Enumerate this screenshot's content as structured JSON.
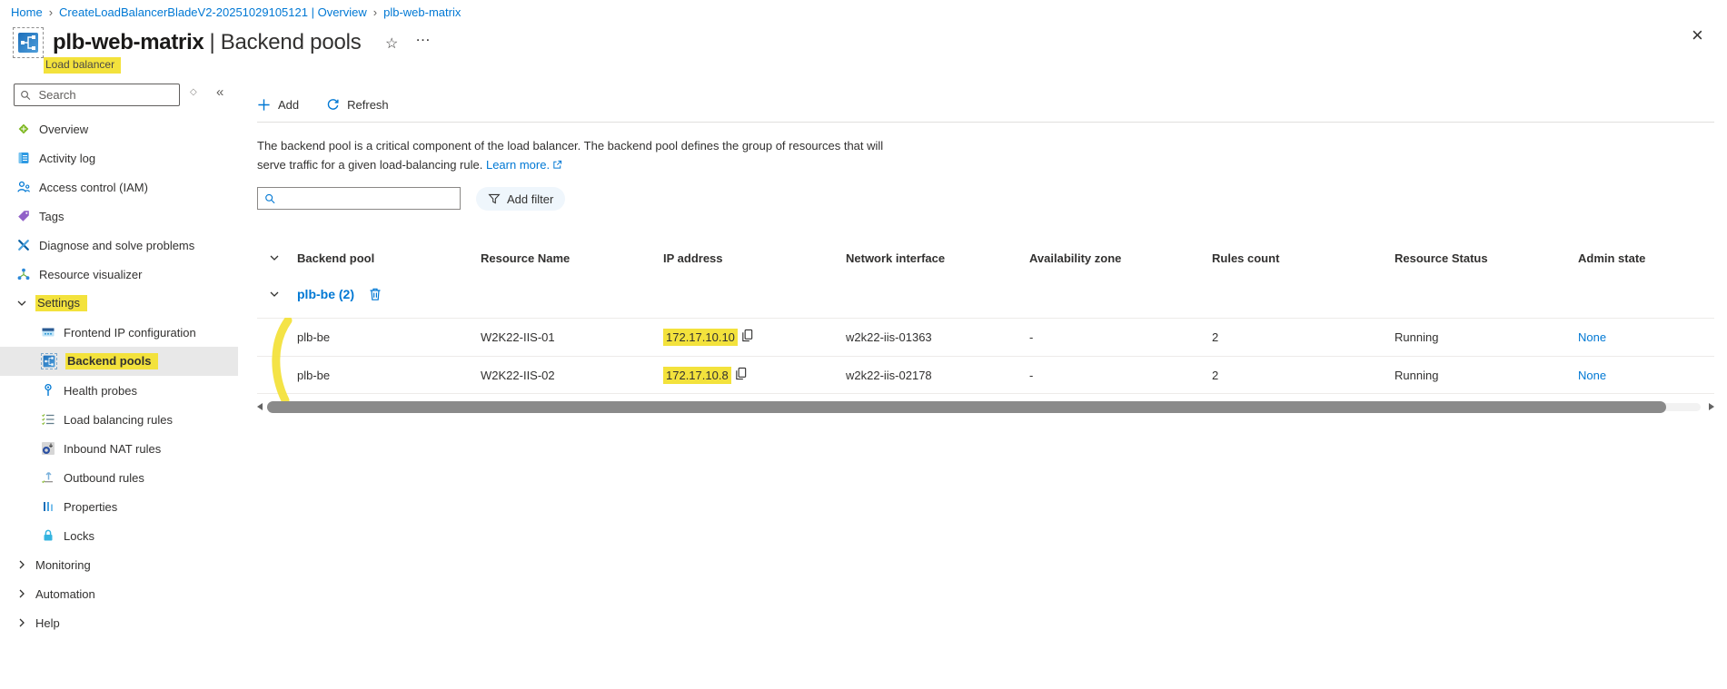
{
  "breadcrumb": {
    "separator": "›",
    "items": [
      "Home",
      "CreateLoadBalancerBladeV2-20251029105121 | Overview",
      "plb-web-matrix"
    ]
  },
  "header": {
    "title": "plb-web-matrix",
    "title_separator": "|",
    "section": "Backend pools",
    "resource_type": "Load balancer",
    "icons": {
      "star": "☆",
      "more": "…",
      "close": "×"
    }
  },
  "sidebar": {
    "search": {
      "placeholder": "Search",
      "value": ""
    },
    "icons": {
      "collapse": "«",
      "reset": "◇"
    },
    "items": [
      {
        "label": "Overview"
      },
      {
        "label": "Activity log"
      },
      {
        "label": "Access control (IAM)"
      },
      {
        "label": "Tags"
      },
      {
        "label": "Diagnose and solve problems"
      },
      {
        "label": "Resource visualizer"
      },
      {
        "label": "Settings"
      },
      {
        "label": "Frontend IP configuration"
      },
      {
        "label": "Backend pools"
      },
      {
        "label": "Health probes"
      },
      {
        "label": "Load balancing rules"
      },
      {
        "label": "Inbound NAT rules"
      },
      {
        "label": "Outbound rules"
      },
      {
        "label": "Properties"
      },
      {
        "label": "Locks"
      },
      {
        "label": "Monitoring"
      },
      {
        "label": "Automation"
      },
      {
        "label": "Help"
      }
    ]
  },
  "toolbar": {
    "add": "Add",
    "refresh": "Refresh"
  },
  "description": {
    "line1": "The backend pool is a critical component of the load balancer. The backend pool defines the group of resources that will",
    "line2": "serve traffic for a given load-balancing rule.",
    "learn_more": "Learn more."
  },
  "filter": {
    "search_value": "",
    "add_filter": "Add filter"
  },
  "table": {
    "columns": [
      "Backend pool",
      "Resource Name",
      "IP address",
      "Network interface",
      "Availability zone",
      "Rules count",
      "Resource Status",
      "Admin state"
    ],
    "group": {
      "name": "plb-be (2)"
    },
    "rows": [
      {
        "backend_pool": "plb-be",
        "resource_name": "W2K22-IIS-01",
        "ip_address": "172.17.10.10",
        "network_interface": "w2k22-iis-01363",
        "availability_zone": "-",
        "rules_count": "2",
        "resource_status": "Running",
        "admin_state": "None"
      },
      {
        "backend_pool": "plb-be",
        "resource_name": "W2K22-IIS-02",
        "ip_address": "172.17.10.8",
        "network_interface": "w2k22-iis-02178",
        "availability_zone": "-",
        "rules_count": "2",
        "resource_status": "Running",
        "admin_state": "None"
      }
    ]
  },
  "colors": {
    "accent": "#0078d4",
    "highlight": "#f3e23c",
    "selected_bg": "#e8e8e8"
  }
}
